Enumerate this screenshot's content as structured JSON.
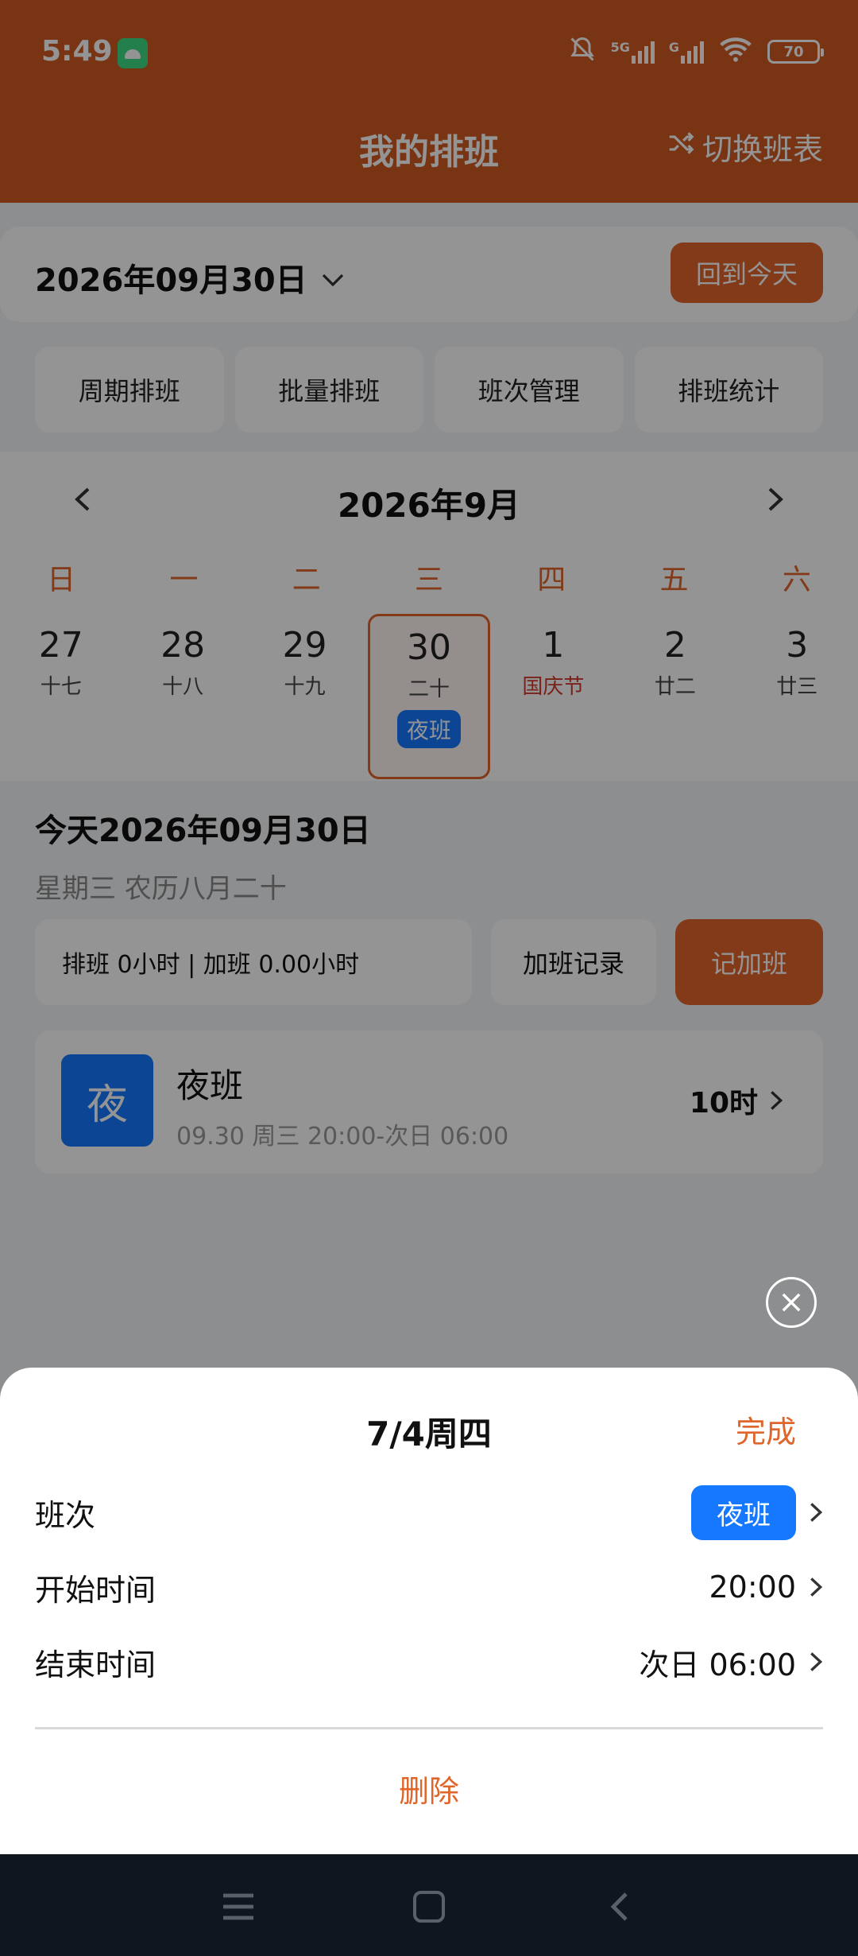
{
  "status_bar": {
    "time": "5:49",
    "network": "5G",
    "network2": "G",
    "battery": "70"
  },
  "app_bar": {
    "title": "我的排班",
    "switch_label": "切换班表"
  },
  "date_row": {
    "date": "2026年09月30日",
    "today_button": "回到今天"
  },
  "tools": [
    "周期排班",
    "批量排班",
    "班次管理",
    "排班统计"
  ],
  "calendar": {
    "month": "2026年9月",
    "weekdays": [
      "日",
      "一",
      "二",
      "三",
      "四",
      "五",
      "六"
    ],
    "days": [
      {
        "num": "27",
        "lunar": "十七"
      },
      {
        "num": "28",
        "lunar": "十八"
      },
      {
        "num": "29",
        "lunar": "十九"
      },
      {
        "num": "30",
        "lunar": "二十",
        "shift": "夜班",
        "selected": true
      },
      {
        "num": "1",
        "lunar": "国庆节",
        "holiday": true
      },
      {
        "num": "2",
        "lunar": "廿二"
      },
      {
        "num": "3",
        "lunar": "廿三"
      }
    ]
  },
  "today": {
    "title": "今天2026年09月30日",
    "subtitle": "星期三 农历八月二十",
    "stats": "排班 0小时 | 加班 0.00小时",
    "ot_record": "加班记录",
    "ot_add": "记加班"
  },
  "shift_card": {
    "avatar": "夜",
    "name": "夜班",
    "time": "09.30  周三 20:00-次日 06:00",
    "hours": "10时"
  },
  "sheet": {
    "title": "7/4周四",
    "done": "完成",
    "rows": [
      {
        "label": "班次",
        "value": "夜班"
      },
      {
        "label": "开始时间",
        "value": "20:00"
      },
      {
        "label": "结束时间",
        "value": "次日 06:00"
      }
    ],
    "delete": "删除"
  },
  "colors": {
    "brand": "#e0652a",
    "header": "#d05a23",
    "shift_blue": "#1677ff"
  }
}
